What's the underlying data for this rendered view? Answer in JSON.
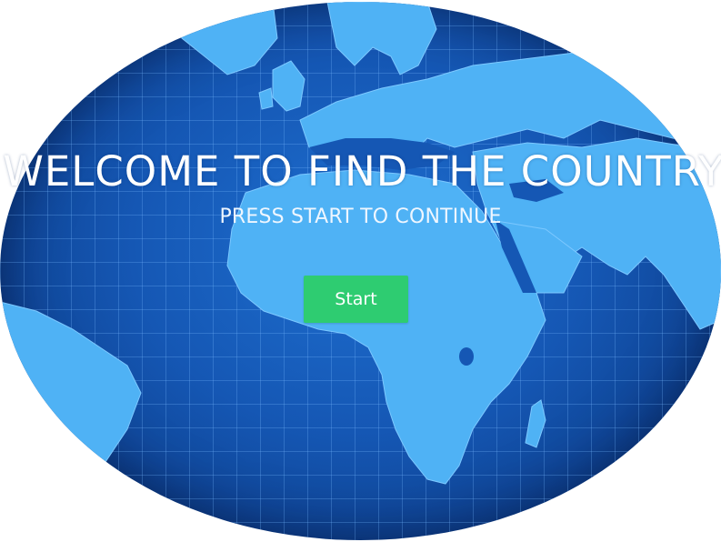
{
  "screen": {
    "title": "WELCOME TO FIND THE COUNTRY",
    "subtitle": "PRESS START TO CONTINUE",
    "start_label": "Start"
  },
  "colors": {
    "ocean": "#1557b4",
    "land": "#4fb2f5",
    "button": "#2ecc71",
    "text": "#ffffff"
  }
}
